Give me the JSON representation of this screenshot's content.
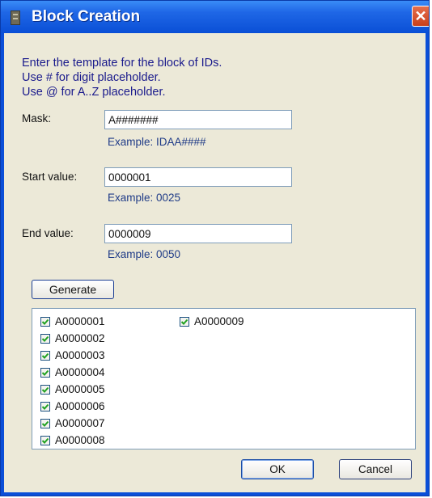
{
  "window": {
    "title": "Block Creation",
    "close_glyph": "✕",
    "app_icon": "app-icon"
  },
  "instructions": [
    "Enter the template for the block of IDs.",
    "Use # for digit placeholder.",
    "Use @ for A..Z placeholder."
  ],
  "mask": {
    "label": "Mask:",
    "value": "A#######",
    "example": "Example: IDAA####"
  },
  "start": {
    "label": "Start value:",
    "value": "0000001",
    "example": "Example: 0025"
  },
  "end": {
    "label": "End value:",
    "value": "0000009",
    "example": "Example: 0050"
  },
  "generate_label": "Generate",
  "items_col1": [
    {
      "label": "A0000001",
      "checked": true
    },
    {
      "label": "A0000002",
      "checked": true
    },
    {
      "label": "A0000003",
      "checked": true
    },
    {
      "label": "A0000004",
      "checked": true
    },
    {
      "label": "A0000005",
      "checked": true
    },
    {
      "label": "A0000006",
      "checked": true
    },
    {
      "label": "A0000007",
      "checked": true
    },
    {
      "label": "A0000008",
      "checked": true
    }
  ],
  "items_col2": [
    {
      "label": "A0000009",
      "checked": true
    }
  ],
  "ok_label": "OK",
  "cancel_label": "Cancel"
}
